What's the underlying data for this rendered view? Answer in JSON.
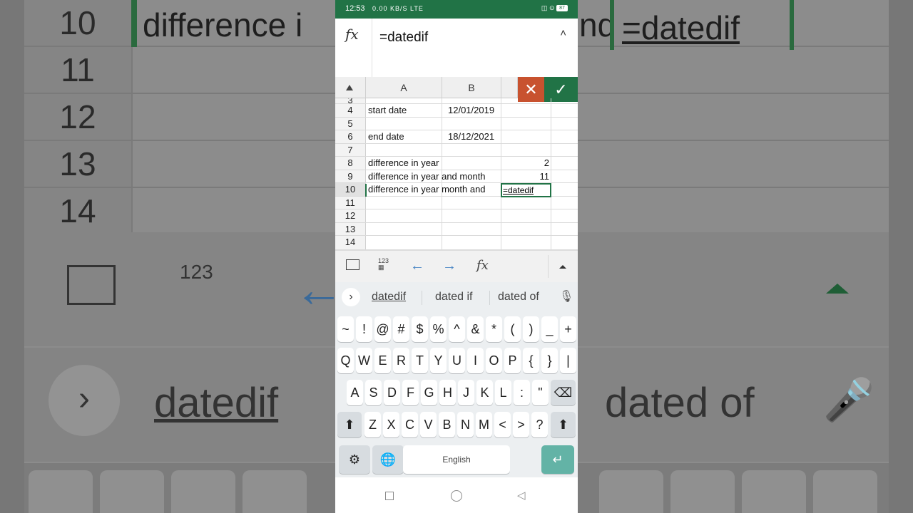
{
  "status": {
    "time": "12:53",
    "signal_text": "0.00 KB/S LTE",
    "battery": "87"
  },
  "formula_bar": {
    "fx_label": "fx",
    "value": "=datedif",
    "collapse_icon": "chevron-up-icon"
  },
  "sheet": {
    "columns": [
      "A",
      "B"
    ],
    "rows": [
      {
        "num": "3",
        "a": "",
        "b": "",
        "c": ""
      },
      {
        "num": "4",
        "a": "start date",
        "b": "12/01/2019",
        "c": ""
      },
      {
        "num": "5",
        "a": "",
        "b": "",
        "c": ""
      },
      {
        "num": "6",
        "a": "end date",
        "b": "18/12/2021",
        "c": ""
      },
      {
        "num": "7",
        "a": "",
        "b": "",
        "c": ""
      },
      {
        "num": "8",
        "a": "difference in year",
        "b": "",
        "c": "2"
      },
      {
        "num": "9",
        "a": "difference in year and month",
        "b": "",
        "c": "11"
      },
      {
        "num": "10",
        "a": "difference in year month and",
        "b": "",
        "c": "=datedif"
      },
      {
        "num": "11",
        "a": "",
        "b": "",
        "c": ""
      },
      {
        "num": "12",
        "a": "",
        "b": "",
        "c": ""
      },
      {
        "num": "13",
        "a": "",
        "b": "",
        "c": ""
      },
      {
        "num": "14",
        "a": "",
        "b": "",
        "c": ""
      }
    ],
    "active_cell_value": "=datedif"
  },
  "suggestions": [
    "datedif",
    "dated if",
    "dated of"
  ],
  "keyboard": {
    "row1": [
      "~",
      "!",
      "@",
      "#",
      "$",
      "%",
      "^",
      "&",
      "*",
      "(",
      ")",
      "_",
      "+"
    ],
    "row2": [
      "Q",
      "W",
      "E",
      "R",
      "T",
      "Y",
      "U",
      "I",
      "O",
      "P",
      "{",
      "}",
      "|"
    ],
    "row3": [
      "A",
      "S",
      "D",
      "F",
      "G",
      "H",
      "J",
      "K",
      "L",
      ":",
      "\""
    ],
    "row4": [
      "Z",
      "X",
      "C",
      "V",
      "B",
      "N",
      "M",
      "<",
      ">",
      "?"
    ],
    "space_label": "English",
    "toolbar_123": "123"
  },
  "background": {
    "rows": [
      "10",
      "11",
      "12",
      "13",
      "14"
    ],
    "row10_left": "difference i",
    "row10_mid": "nd",
    "row10_right": "=datedif",
    "sugg_left": "datedif",
    "sugg_right": "dated of",
    "toolbar_123": "123"
  },
  "colors": {
    "accent": "#217346",
    "cancel": "#c8522f",
    "enter": "#63b3a6"
  }
}
